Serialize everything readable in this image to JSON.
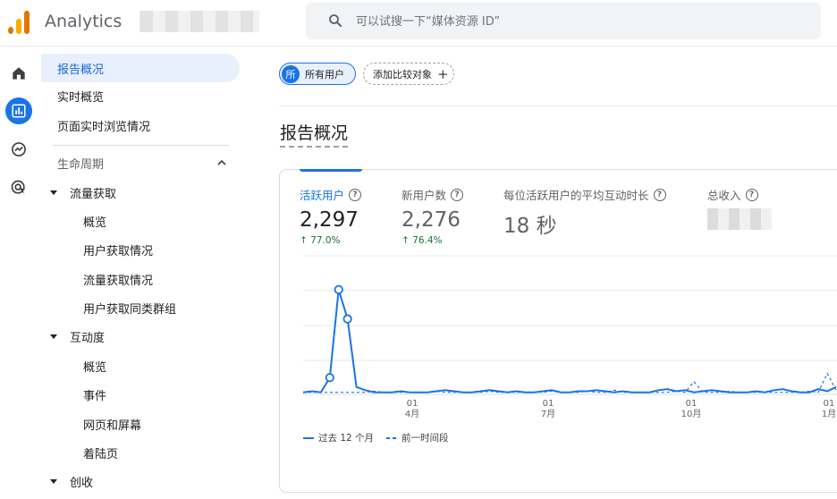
{
  "app": {
    "title": "Analytics"
  },
  "search": {
    "placeholder": "可以试搜一下“媒体资源 ID”"
  },
  "sidebar": {
    "items": [
      {
        "label": "报告概况",
        "active": true
      },
      {
        "label": "实时概览"
      },
      {
        "label": "页面实时浏览情况"
      }
    ],
    "section": {
      "label": "生命周期"
    },
    "groups": [
      {
        "label": "流量获取",
        "children": [
          "概览",
          "用户获取情况",
          "流量获取情况",
          "用户获取同类群组"
        ]
      },
      {
        "label": "互动度",
        "children": [
          "概览",
          "事件",
          "网页和屏幕",
          "着陆页"
        ]
      },
      {
        "label": "创收",
        "children": []
      }
    ]
  },
  "filters": {
    "all_users": {
      "badge": "所",
      "label": "所有用户"
    },
    "add_compare": {
      "label": "添加比较对象"
    }
  },
  "page": {
    "title": "报告概况"
  },
  "metrics": [
    {
      "label": "活跃用户",
      "value": "2,297",
      "delta": "↑ 77.0%",
      "active": true
    },
    {
      "label": "新用户数",
      "value": "2,276",
      "delta": "↑ 76.4%"
    },
    {
      "label": "每位活跃用户的平均互动时长",
      "value": "18 秒"
    },
    {
      "label": "总收入",
      "value": ""
    }
  ],
  "chart_data": {
    "type": "line",
    "x_tick_labels": [
      {
        "day": "01",
        "month": "4月"
      },
      {
        "day": "01",
        "month": "7月"
      },
      {
        "day": "01",
        "month": "10月"
      },
      {
        "day": "01",
        "month": "1月"
      }
    ],
    "series": [
      {
        "name": "过去 12 个月",
        "style": "solid",
        "values": [
          2,
          3,
          2,
          16,
          100,
          72,
          7,
          4,
          2,
          2,
          2,
          3,
          2,
          2,
          2,
          3,
          4,
          3,
          2,
          2,
          3,
          4,
          3,
          2,
          3,
          2,
          2,
          3,
          4,
          2,
          2,
          3,
          3,
          4,
          3,
          2,
          3,
          2,
          2,
          2,
          4,
          5,
          3,
          4,
          2,
          3,
          4,
          3,
          2,
          2,
          2,
          3,
          2,
          4,
          5,
          3,
          2,
          2,
          5,
          3,
          7
        ]
      },
      {
        "name": "前一时间段",
        "style": "dashed",
        "values": [
          2,
          2,
          2,
          2,
          2,
          2,
          2,
          2,
          3,
          2,
          2,
          2,
          2,
          2,
          2,
          3,
          2,
          2,
          2,
          2,
          2,
          3,
          2,
          2,
          2,
          2,
          2,
          2,
          3,
          2,
          2,
          2,
          3,
          2,
          2,
          4,
          2,
          2,
          2,
          2,
          2,
          2,
          3,
          2,
          12,
          2,
          2,
          2,
          3,
          2,
          2,
          2,
          2,
          2,
          2,
          2,
          2,
          3,
          2,
          20,
          4
        ]
      }
    ],
    "ylim": [
      0,
      105
    ],
    "colors": {
      "line": "#1a73e8"
    }
  }
}
